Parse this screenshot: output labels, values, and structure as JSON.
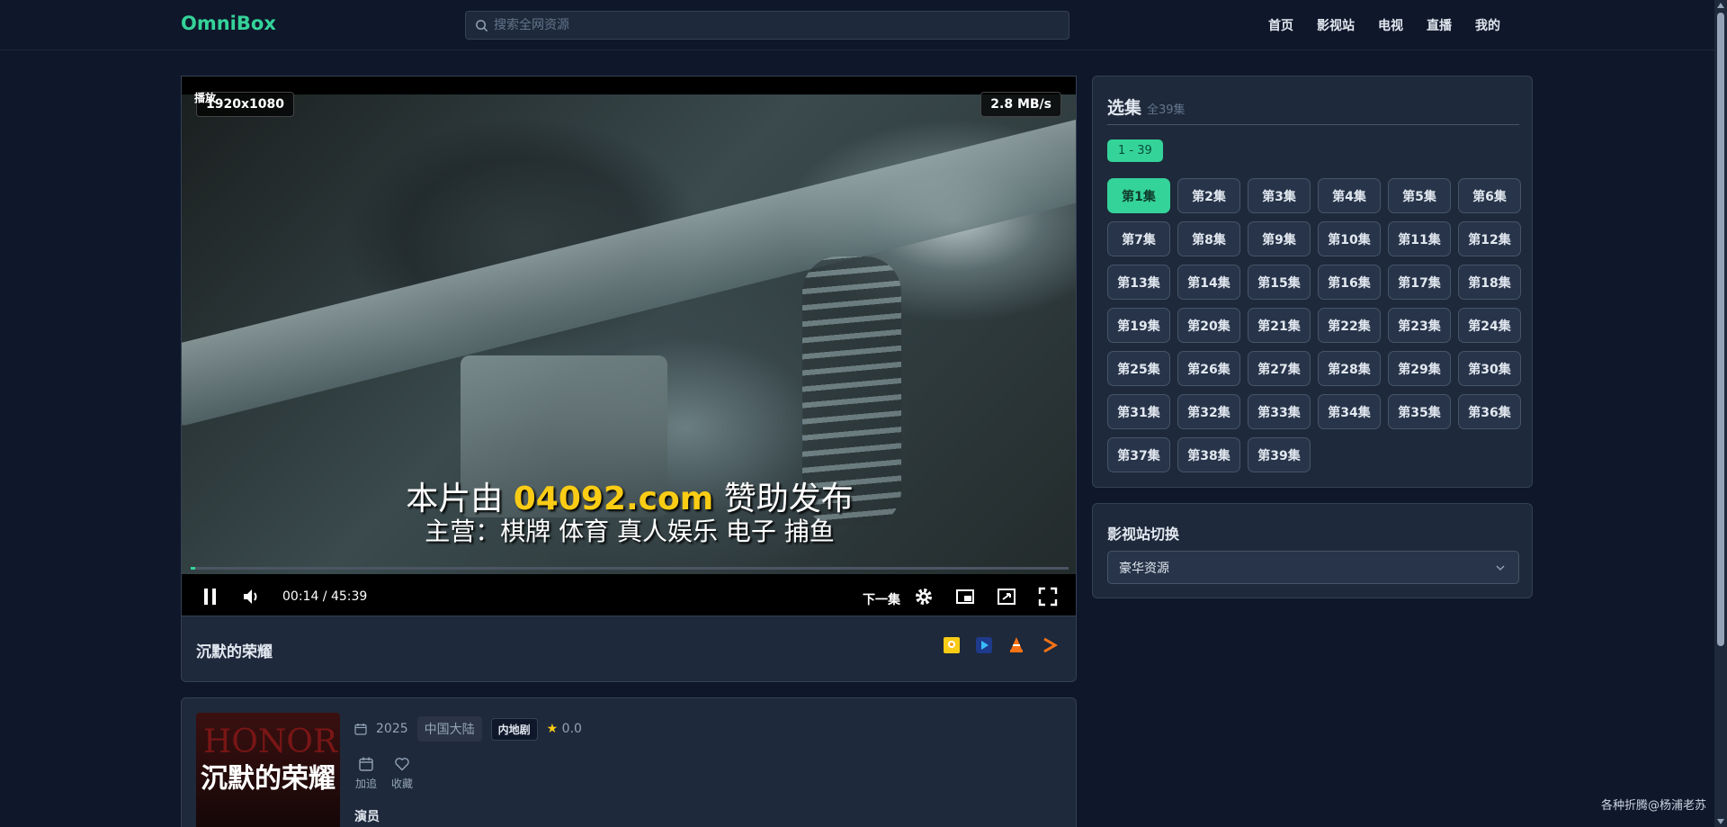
{
  "header": {
    "logo": "OmniBox",
    "search_placeholder": "搜索全网资源",
    "nav": [
      "首页",
      "影视站",
      "电视",
      "直播",
      "我的"
    ]
  },
  "player": {
    "play_tag": "播放",
    "resolution": "1920x1080",
    "speed": "2.8 MB/s",
    "subtitle_line1_prefix": "本片由",
    "subtitle_line1_highlight": "04092.com",
    "subtitle_line1_suffix": "赞助发布",
    "subtitle_line2": "主营：棋牌  体育  真人娱乐   电子  捕鱼",
    "current_time": "00:14",
    "duration": "45:39",
    "time_text": "00:14 / 45:39",
    "progress": 0.0051,
    "next_label": "下一集"
  },
  "video_info": {
    "title": "沉默的荣耀",
    "year": "2025",
    "region": "中国大陆",
    "genre": "内地剧",
    "rating": "0.0",
    "poster_title": "沉默的荣耀",
    "actions": [
      "加追",
      "收藏"
    ],
    "cast_label": "演员"
  },
  "episodes": {
    "heading": "选集",
    "total": "全39集",
    "range": "1 - 39",
    "items": [
      "第1集",
      "第2集",
      "第3集",
      "第4集",
      "第5集",
      "第6集",
      "第7集",
      "第8集",
      "第9集",
      "第10集",
      "第11集",
      "第12集",
      "第13集",
      "第14集",
      "第15集",
      "第16集",
      "第17集",
      "第18集",
      "第19集",
      "第20集",
      "第21集",
      "第22集",
      "第23集",
      "第24集",
      "第25集",
      "第26集",
      "第27集",
      "第28集",
      "第29集",
      "第30集",
      "第31集",
      "第32集",
      "第33集",
      "第34集",
      "第35集",
      "第36集",
      "第37集",
      "第38集",
      "第39集"
    ],
    "active_index": 0
  },
  "source": {
    "heading": "影视站切换",
    "selected": "豪华资源"
  },
  "footer_note": "各种折腾@杨浦老苏",
  "colors": {
    "accent": "#34d399",
    "background": "#0f172a",
    "panel": "#1e293b"
  }
}
